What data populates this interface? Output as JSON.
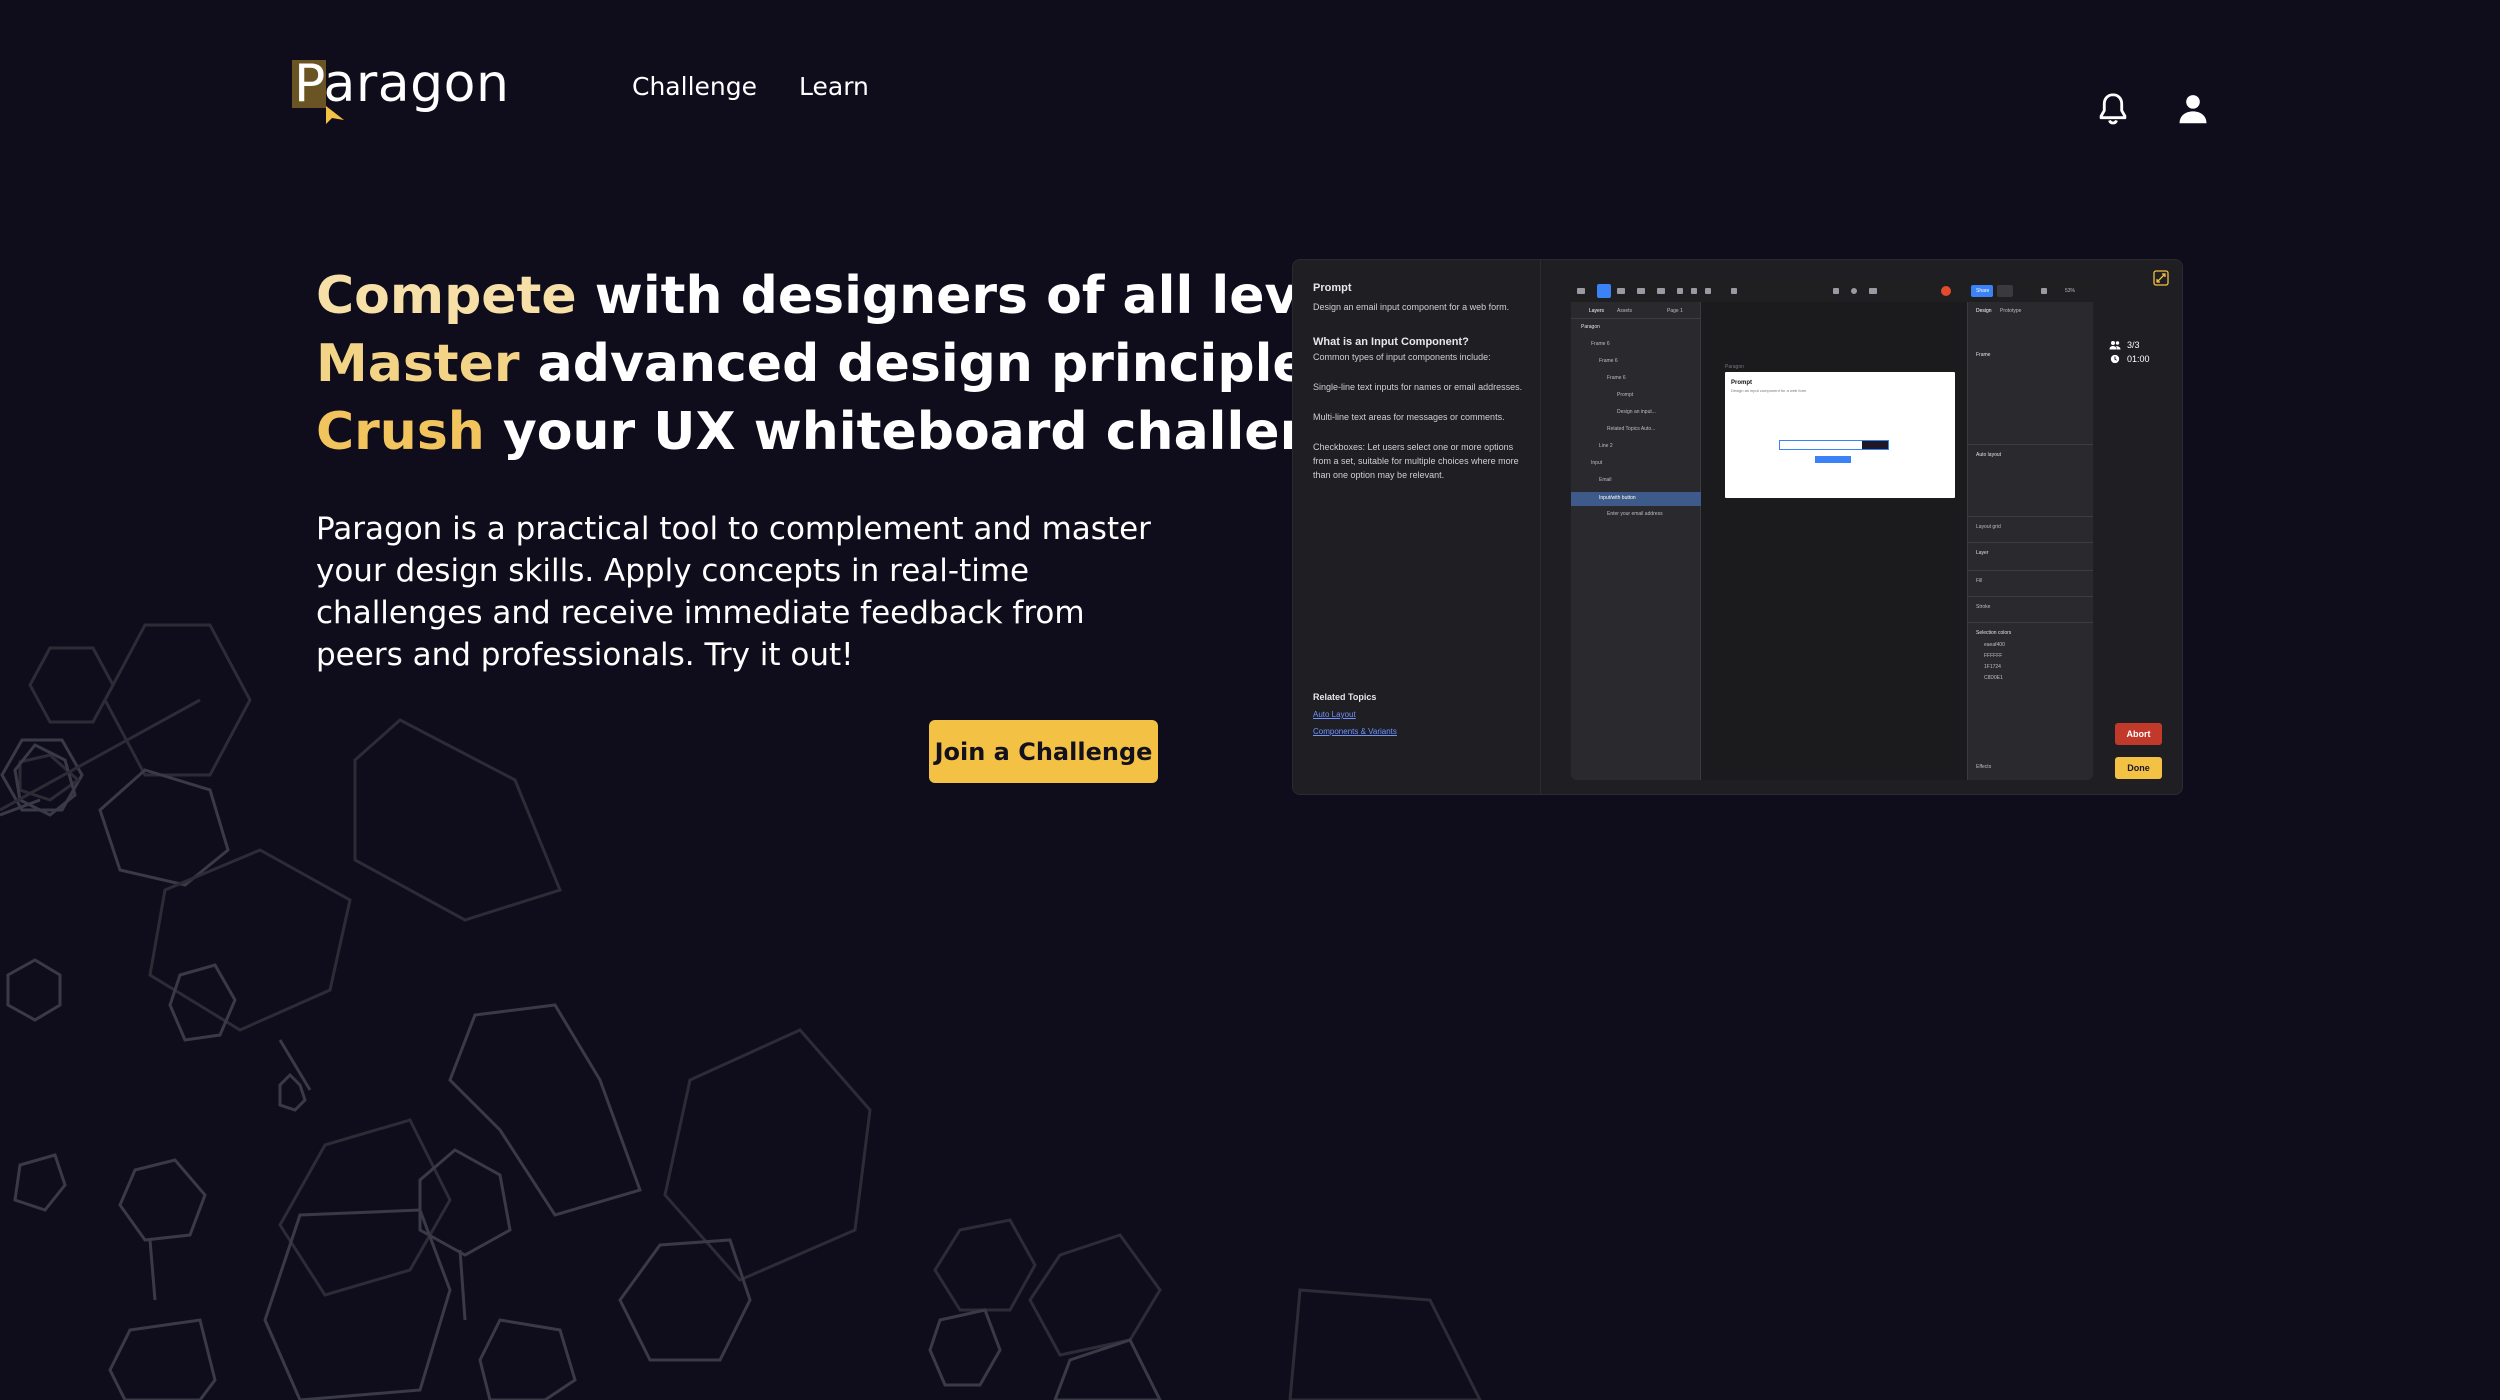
{
  "brand": {
    "name": "Paragon",
    "accent": "#f3c245"
  },
  "nav": {
    "items": [
      {
        "label": "Challenge"
      },
      {
        "label": "Learn"
      }
    ]
  },
  "header_icons": [
    "bell-icon",
    "user-icon"
  ],
  "hero": {
    "line1": {
      "highlight": "Compete",
      "rest": " with designers of all levels."
    },
    "line2": {
      "highlight": "Master",
      "rest": " advanced design principles."
    },
    "line3": {
      "highlight": "Crush",
      "rest": " your UX whiteboard challenge."
    },
    "description": "Paragon is a practical tool to complement and master your design skills. Apply concepts in real-time challenges and receive immediate feedback from peers and professionals. Try it out!",
    "cta_label": "Join a Challenge"
  },
  "preview": {
    "prompt_title": "Prompt",
    "prompt_text": "Design an email input component for a web form.",
    "section_title": "What is an Input Component?",
    "section_intro": "Common types of input components include:",
    "item1": "Single-line text inputs for names or email addresses.",
    "item2": "Multi-line text areas for messages or comments.",
    "item3": "Checkboxes: Let users select one or more options from a set, suitable for multiple choices where more than one option may be relevant.",
    "related_title": "Related Topics",
    "related_links": [
      "Auto Layout",
      "Components & Variants"
    ],
    "participants": "3/3",
    "timer": "01:00",
    "abort_label": "Abort",
    "done_label": "Done",
    "figma": {
      "tabs": [
        "Layers",
        "Assets",
        "Page 1"
      ],
      "layers": [
        "Paragon",
        "Frame 6",
        "Frame 6",
        "Frame 6",
        "Prompt",
        "Design an input...",
        "Related Topics Auto...",
        "Line 2",
        "Input",
        "Email",
        "Input/with button",
        "Enter your email address"
      ],
      "right_tabs": [
        "Design",
        "Prototype"
      ],
      "right_sections": [
        "Frame",
        "Auto layout",
        "Layout grid",
        "Layer",
        "Fill",
        "Stroke",
        "Selection colors",
        "Effects"
      ],
      "share_label": "Share",
      "zoom": "53%",
      "canvas_frame_label": "Paragon",
      "canvas_prompt": "Prompt",
      "canvas_prompt_text": "Design an input component for a web form",
      "colors": [
        "eaeaf400",
        "FFFFFF",
        "1F1724",
        "C8D0E1"
      ]
    }
  }
}
